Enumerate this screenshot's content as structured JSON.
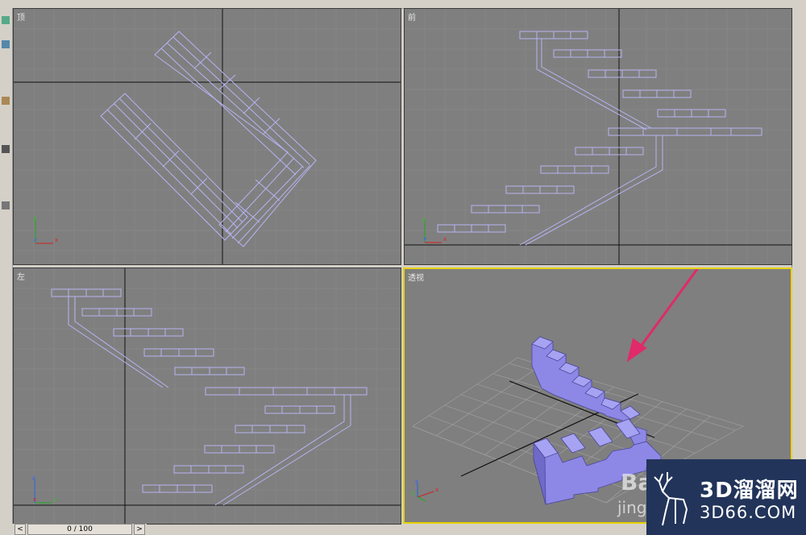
{
  "viewports": {
    "top": {
      "label": "顶"
    },
    "front": {
      "label": "前"
    },
    "left": {
      "label": "左"
    },
    "perspective": {
      "label": "透视"
    }
  },
  "axes": {
    "x": "x",
    "y": "y",
    "z": "z"
  },
  "timeline": {
    "frame": "0 / 100",
    "prev": "<",
    "next": ">"
  },
  "watermark": {
    "brand_cn": "3D溜溜网",
    "brand_url": "3D66.COM",
    "baidu": "Bai",
    "baidu_sub": "jing"
  },
  "colors": {
    "viewport_bg": "#7f7f7f",
    "wire": "#b7b3f2",
    "solid": "#8d88e6",
    "active_border": "#e8d200",
    "arrow": "#e02a6a"
  },
  "icons": [
    "select-icon",
    "move-icon",
    "rotate-icon",
    "scale-icon",
    "link-icon"
  ]
}
